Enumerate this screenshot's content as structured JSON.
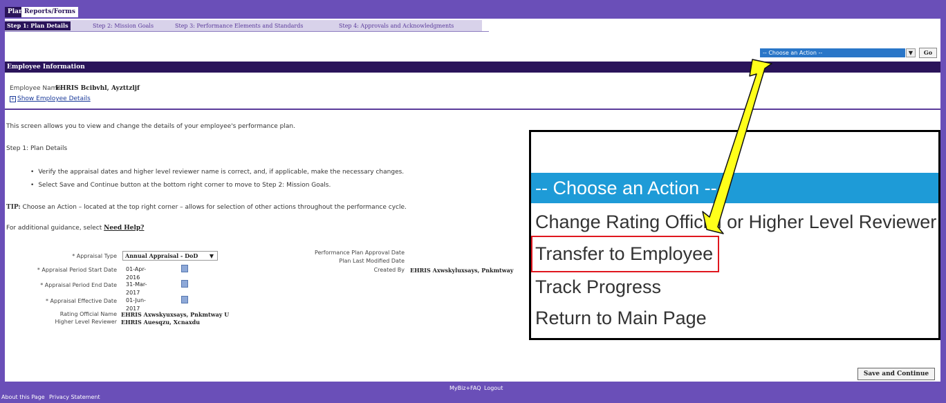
{
  "top_tabs": [
    "Plan",
    "Reports/Forms"
  ],
  "step_tabs": [
    "Step 1: Plan Details",
    "Step 2: Mission Goals",
    "Step 3: Performance Elements and Standards",
    "Step 4: Approvals and Acknowledgments"
  ],
  "action": {
    "selected": "-- Choose an Action --",
    "go_label": "Go"
  },
  "employee_section": {
    "title": "Employee Information",
    "name_label": "Employee Name",
    "name_value": "EHRIS Bcibvhl, Ayzttzljf",
    "show_details": "Show Employee Details"
  },
  "instructions": {
    "intro": "This screen allows you to view and change the details of your employee's performance plan.",
    "step_title": "Step 1: Plan Details",
    "bullets": [
      "Verify the appraisal dates and higher level reviewer name is correct, and, if applicable, make the necessary changes.",
      "Select Save and Continue button at the bottom right corner to move to Step 2: Mission Goals."
    ],
    "tip_label": "TIP:",
    "tip_text": " Choose an Action – located at the top right corner – allows for selection of other actions throughout the performance cycle.",
    "guidance_text": "For additional guidance, select ",
    "help_link": "Need Help?"
  },
  "form": {
    "appraisal_type_label": "* Appraisal Type",
    "appraisal_type_value": "Annual Appraisal - DoD",
    "period_start_label": "* Appraisal Period Start Date",
    "period_start_value": "01-Apr-2016",
    "period_end_label": "* Appraisal Period End Date",
    "period_end_value": "31-Mar-2017",
    "effective_label": "* Appraisal Effective Date",
    "effective_value": "01-Jun-2017",
    "rating_official_label": "Rating Official Name",
    "rating_official_value": "EHRIS Axwskyuxsays, Pnkmtway U",
    "hlr_label": "Higher Level Reviewer",
    "hlr_value": "EHRIS Auesqzu, Xcnaxdu",
    "approval_date_label": "Performance Plan Approval Date",
    "modified_date_label": "Plan Last Modified Date",
    "created_by_label": "Created By",
    "created_by_value": "EHRIS Axwskyluxsays, Pnkmtway"
  },
  "zoom_popup": {
    "selected": "-- Choose an Action --",
    "options": [
      "Change Rating Official or Higher Level Reviewer",
      "Transfer to Employee",
      "Track Progress",
      "Return to Main Page"
    ]
  },
  "save_continue": "Save and Continue",
  "footer": {
    "links_center": [
      "MyBiz+",
      "FAQ",
      "Logout"
    ],
    "links_left": [
      "About this Page",
      "Privacy Statement"
    ]
  },
  "colors": {
    "frame": "#6a4fb8",
    "dark_header": "#2a145a",
    "select_blue": "#1e9bd7",
    "highlight_red": "#e0161e",
    "arrow_yellow": "#ffff1a"
  }
}
